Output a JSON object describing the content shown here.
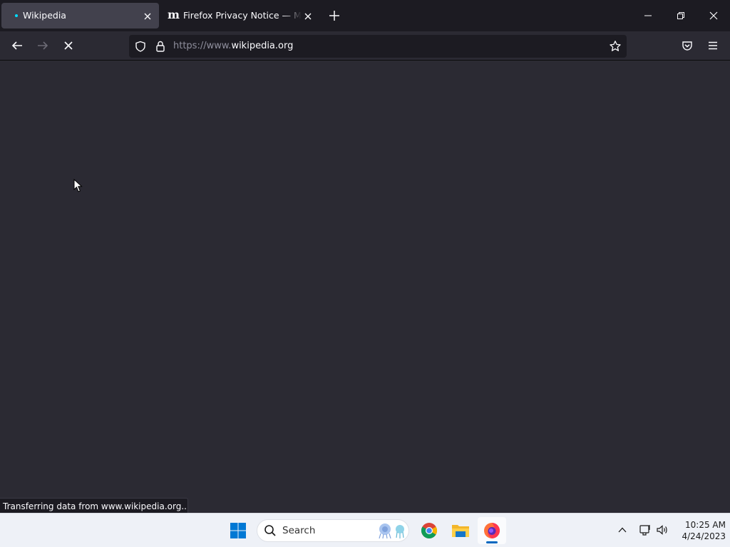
{
  "browser": {
    "tabs": [
      {
        "title": "Wikipedia",
        "state": "loading",
        "active": true
      },
      {
        "title": "Firefox Privacy Notice — Mozilla",
        "favicon": "mozilla-m-icon",
        "active": false
      }
    ],
    "url": {
      "scheme_prefix": "https://www.",
      "host": "wikipedia.org"
    },
    "status_text": "Transferring data from www.wikipedia.org..."
  },
  "icons": {
    "back": "back-arrow-icon",
    "forward": "forward-arrow-icon",
    "stop": "stop-loading-icon",
    "shield": "tracking-protection-shield-icon",
    "lock": "lock-icon",
    "bookmark": "star-icon",
    "pocket": "pocket-icon",
    "menu": "hamburger-menu-icon"
  },
  "taskbar": {
    "search_label": "Search",
    "apps": [
      "windows-start",
      "chrome",
      "file-explorer",
      "firefox"
    ],
    "time": "10:25 AM",
    "date": "4/24/2023"
  },
  "colors": {
    "tab_strip": "#1c1b22",
    "toolbar": "#2b2a33",
    "active_tab": "#42414d",
    "loading_dot": "#00ddff",
    "taskbar": "#eef1f7"
  }
}
